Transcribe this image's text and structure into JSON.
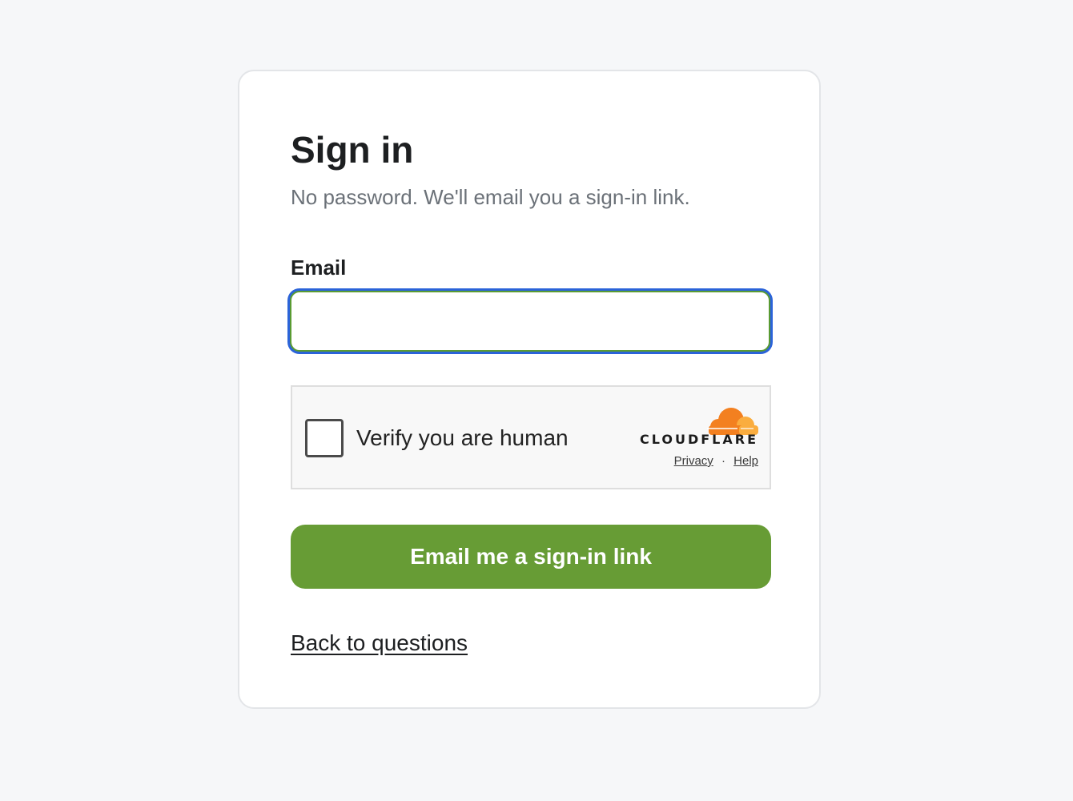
{
  "signin": {
    "title": "Sign in",
    "subtitle": "No password. We'll email you a sign-in link.",
    "email_label": "Email",
    "email_value": "",
    "submit_label": "Email me a sign-in link",
    "back_link": "Back to questions"
  },
  "turnstile": {
    "checkbox_label": "Verify you are human",
    "brand": "CLOUDFLARE",
    "privacy_link": "Privacy",
    "separator": "·",
    "help_link": "Help",
    "brand_color": "#f38020"
  },
  "colors": {
    "page_background": "#f6f7f9",
    "button_green": "#679c35",
    "focus_ring": "#2b63d9"
  }
}
